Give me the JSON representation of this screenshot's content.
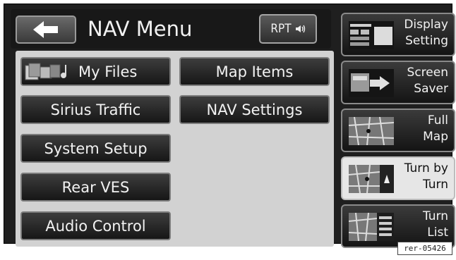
{
  "header": {
    "title": "NAV Menu",
    "rpt_label": "RPT",
    "rpt_icon": "speaker-sound-icon",
    "back_icon": "back-arrow-icon"
  },
  "menu": {
    "buttons": [
      {
        "label": "My Files",
        "icon": "files-icon"
      },
      {
        "label": "Map Items"
      },
      {
        "label": "Sirius Traffic"
      },
      {
        "label": "NAV Settings"
      },
      {
        "label": "System Setup"
      },
      {
        "label": "Rear VES"
      },
      {
        "label": "Audio Control"
      }
    ]
  },
  "side": {
    "items": [
      {
        "label_line1": "Display",
        "label_line2": "Setting",
        "icon": "display-setting-icon",
        "active": false
      },
      {
        "label_line1": "Screen",
        "label_line2": "Saver",
        "icon": "screen-saver-icon",
        "active": false
      },
      {
        "label_line1": "Full",
        "label_line2": "Map",
        "icon": "full-map-icon",
        "active": false
      },
      {
        "label_line1": "Turn by",
        "label_line2": "Turn",
        "icon": "turn-by-turn-icon",
        "active": true
      },
      {
        "label_line1": "Turn",
        "label_line2": "List",
        "icon": "turn-list-icon",
        "active": false
      }
    ]
  },
  "reference": "rer-05426",
  "colors": {
    "screen_bg": "#1f1f1f",
    "panel_bg": "#d2d2d2",
    "button_bg": "#2a2a2a",
    "active_bg": "#e6e6e6"
  }
}
